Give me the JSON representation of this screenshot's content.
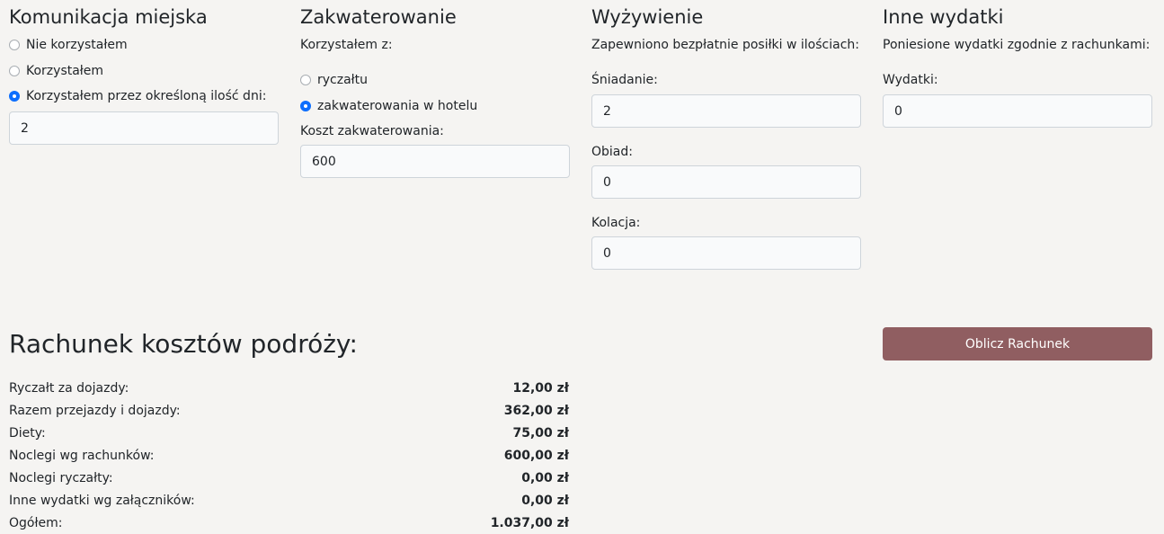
{
  "komunikacja": {
    "title": "Komunikacja miejska",
    "options": [
      {
        "label": "Nie korzystałem",
        "checked": false
      },
      {
        "label": "Korzystałem",
        "checked": false
      },
      {
        "label": "Korzystałem przez określoną ilość dni:",
        "checked": true
      }
    ],
    "days_value": "2"
  },
  "zakwaterowanie": {
    "title": "Zakwaterowanie",
    "intro": "Korzystałem z:",
    "options": [
      {
        "label": "ryczałtu",
        "checked": false
      },
      {
        "label": "zakwaterowania w hotelu",
        "checked": true
      }
    ],
    "cost_label": "Koszt zakwaterowania:",
    "cost_value": "600"
  },
  "wyzywienie": {
    "title": "Wyżywienie",
    "intro": "Zapewniono bezpłatnie posiłki w ilościach:",
    "breakfast_label": "Śniadanie:",
    "breakfast_value": "2",
    "lunch_label": "Obiad:",
    "lunch_value": "0",
    "dinner_label": "Kolacja:",
    "dinner_value": "0"
  },
  "inne": {
    "title": "Inne wydatki",
    "intro": "Poniesione wydatki zgodnie z rachunkami:",
    "expenses_label": "Wydatki:",
    "expenses_value": "0"
  },
  "rachunek": {
    "title": "Rachunek kosztów podróży:",
    "button_label": "Oblicz Rachunek",
    "rows": [
      {
        "label": "Ryczałt za dojazdy:",
        "value": "12,00 zł"
      },
      {
        "label": "Razem przejazdy i dojazdy:",
        "value": "362,00 zł"
      },
      {
        "label": "Diety:",
        "value": "75,00 zł"
      },
      {
        "label": "Noclegi wg rachunków:",
        "value": "600,00 zł"
      },
      {
        "label": "Noclegi ryczałty:",
        "value": "0,00 zł"
      },
      {
        "label": "Inne wydatki wg załączników:",
        "value": "0,00 zł"
      },
      {
        "label": "Ogółem:",
        "value": "1.037,00 zł"
      }
    ]
  },
  "colors": {
    "accent": "#0d6efd",
    "button": "#905e61",
    "background": "#f5f4f2"
  }
}
